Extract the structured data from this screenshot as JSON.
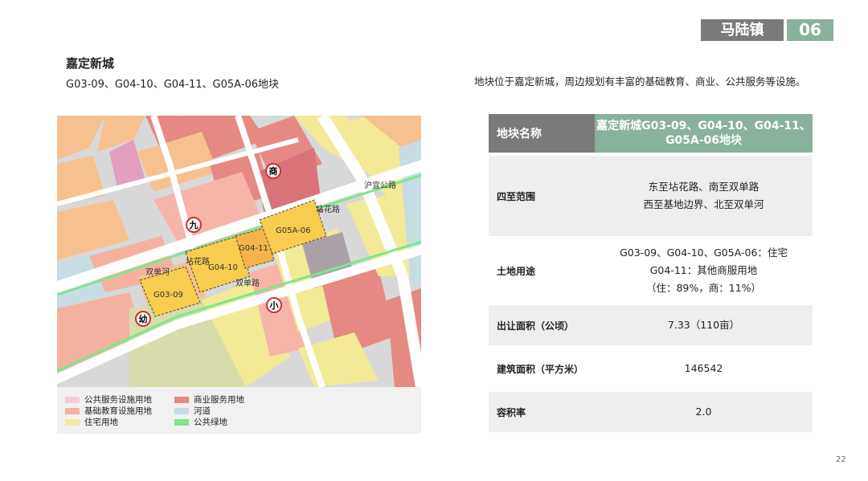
{
  "header": {
    "town": "马陆镇",
    "number": "06"
  },
  "title": "嘉定新城",
  "subtitle": "G03-09、G04-10、G04-11、G05A-06地块",
  "description": "地块位于嘉定新城，周边规划有丰富的基础教育、商业、公共服务等设施。",
  "map": {
    "markers": [
      "商",
      "九",
      "小",
      "幼"
    ],
    "parcels": [
      "G03-09",
      "G04-10",
      "G04-11",
      "G05A-06"
    ],
    "roads": [
      "双单河",
      "双单路",
      "坫花路",
      "沪宜公路",
      "坫花路"
    ]
  },
  "legend": [
    {
      "label": "公共服务设施用地",
      "color": "#f7c9d6"
    },
    {
      "label": "商业服务用地",
      "color": "#e48a82"
    },
    {
      "label": "基础教育设施用地",
      "color": "#f5b19f"
    },
    {
      "label": "河道",
      "color": "#c7dde4"
    },
    {
      "label": "住宅用地",
      "color": "#f3ea98"
    },
    {
      "label": "公共绿地",
      "color": "#7ce78a"
    }
  ],
  "table": {
    "header": {
      "label": "地块名称",
      "value": "嘉定新城G03-09、G04-10、G04-11、G05A-06地块"
    },
    "rows": [
      {
        "label": "四至范围",
        "lines": [
          "东至坫花路、南至双单路",
          "西至基地边界、北至双单河"
        ]
      },
      {
        "label": "土地用途",
        "lines": [
          "G03-09、G04-10、G05A-06：住宅",
          "G04-11：其他商服用地",
          "（住：89%，商：11%）"
        ]
      },
      {
        "label": "出让面积（公顷）",
        "lines": [
          "7.33（110亩）"
        ]
      },
      {
        "label": "建筑面积（平方米）",
        "lines": [
          "146542"
        ]
      },
      {
        "label": "容积率",
        "lines": [
          "2.0"
        ]
      }
    ]
  },
  "page_number": "22",
  "colors": {
    "grey": "#7a7a7a",
    "green": "#88b29c"
  }
}
